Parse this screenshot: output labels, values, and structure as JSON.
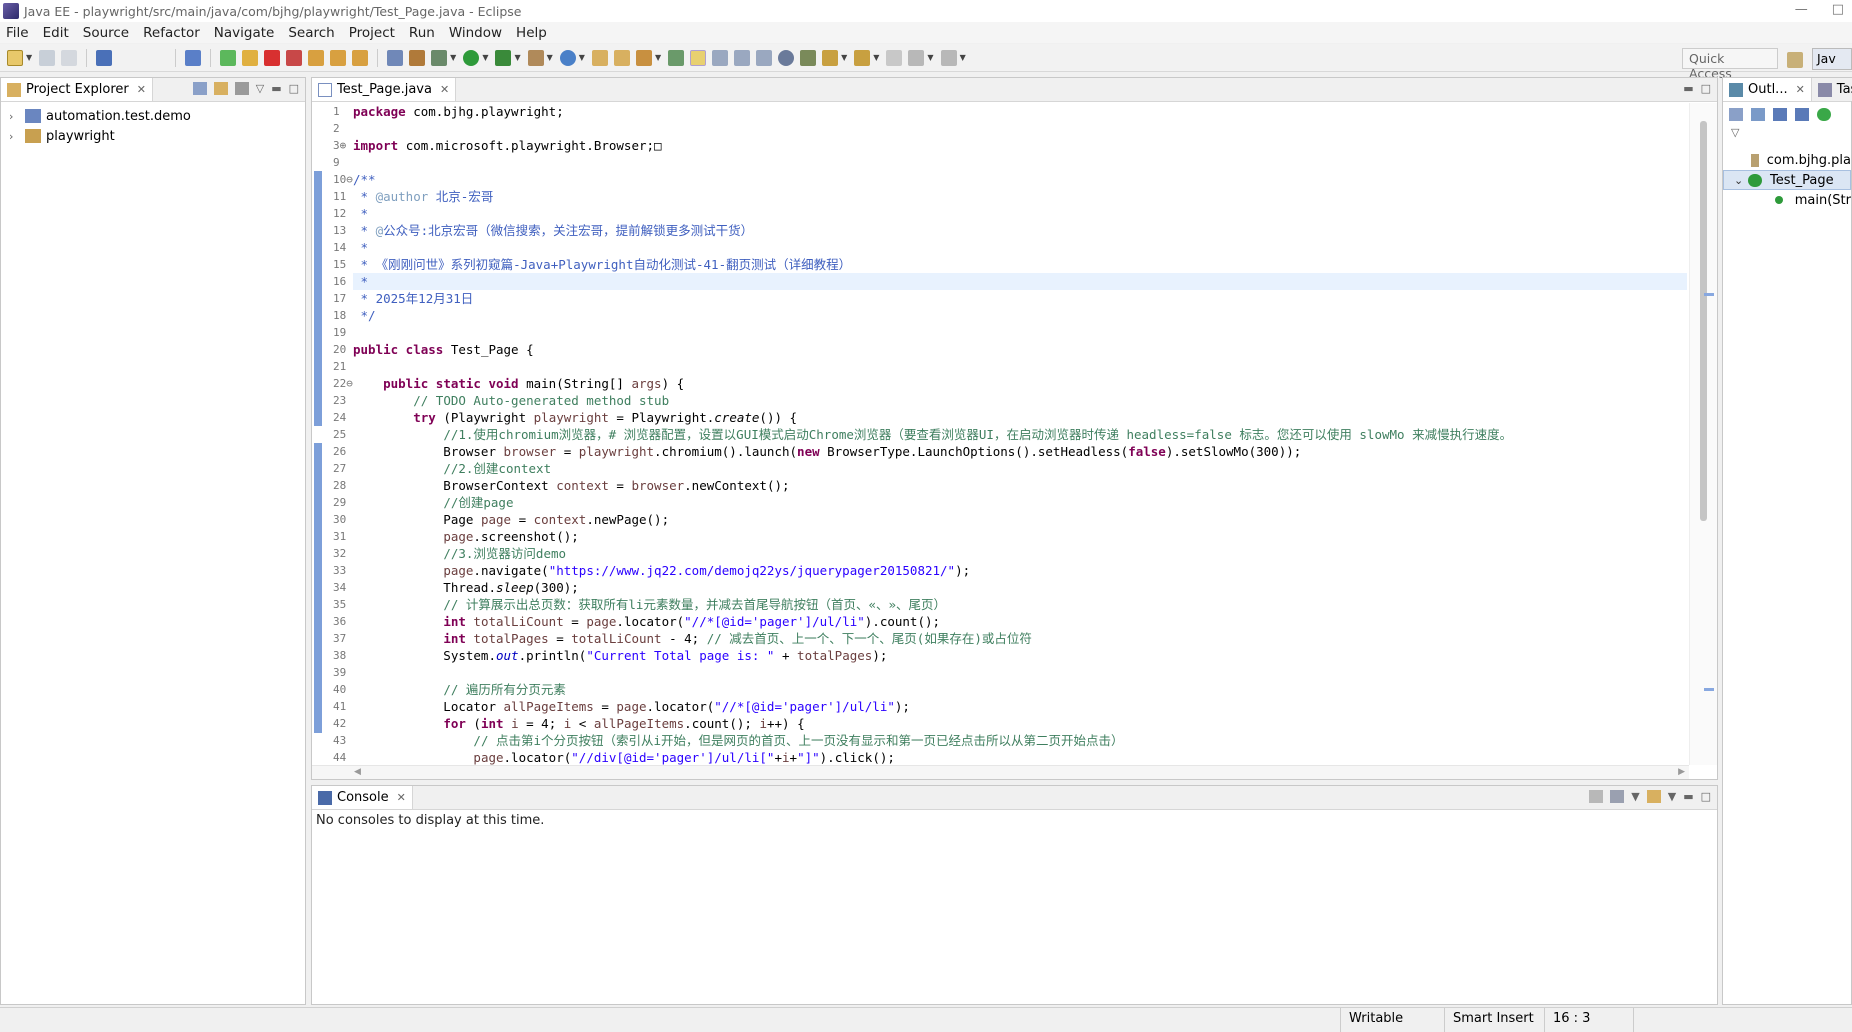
{
  "window": {
    "title": "Java EE - playwright/src/main/java/com/bjhg/playwright/Test_Page.java - Eclipse",
    "controls": [
      "—",
      "□"
    ]
  },
  "menu": [
    "File",
    "Edit",
    "Source",
    "Refactor",
    "Navigate",
    "Search",
    "Project",
    "Run",
    "Window",
    "Help"
  ],
  "toolbar": {
    "quick_access": "Quick Access",
    "perspective_label": "Jav"
  },
  "explorer": {
    "tab_label": "Project Explorer",
    "items": [
      {
        "label": "automation.test.demo"
      },
      {
        "label": "playwright"
      }
    ]
  },
  "editor": {
    "tab_label": "Test_Page.java",
    "line_numbers": [
      "1",
      "2",
      "3",
      "9",
      "10",
      "11",
      "12",
      "13",
      "14",
      "15",
      "16",
      "17",
      "18",
      "19",
      "20",
      "21",
      "22",
      "23",
      "24",
      "25",
      "26",
      "27",
      "28",
      "29",
      "30",
      "31",
      "32",
      "33",
      "34",
      "35",
      "36",
      "37",
      "38",
      "39",
      "40",
      "41",
      "42",
      "43",
      "44"
    ],
    "fold_markers": {
      "3": "⊕",
      "10": "⊖",
      "22": "⊖"
    },
    "highlighted_line_index": 10,
    "lines": [
      [
        [
          "kw",
          "package"
        ],
        [
          "",
          "com.bjhg.playwright;"
        ]
      ],
      [],
      [
        [
          "kw",
          "import"
        ],
        [
          "",
          "com.microsoft.playwright.Browser;□"
        ]
      ],
      [],
      [
        [
          "jd",
          "/**"
        ]
      ],
      [
        [
          "jd",
          " * "
        ],
        [
          "jdtag",
          "@author"
        ],
        [
          "jd",
          " 北京-宏哥"
        ]
      ],
      [
        [
          "jd",
          " *"
        ]
      ],
      [
        [
          "jd",
          " * "
        ],
        [
          "jdtag",
          "@"
        ],
        [
          "jd",
          "公众号:北京宏哥（微信搜索，关注宏哥，提前解锁更多测试干货）"
        ]
      ],
      [
        [
          "jd",
          " *"
        ]
      ],
      [
        [
          "jd",
          " * 《刚刚问世》系列初窥篇-Java+Playwright自动化测试-41-翻页测试（详细教程）"
        ]
      ],
      [
        [
          "jd",
          " *"
        ]
      ],
      [
        [
          "jd",
          " * 2025年12月31日"
        ]
      ],
      [
        [
          "jd",
          " */"
        ]
      ],
      [],
      [
        [
          "kw",
          "public class"
        ],
        [
          "",
          "Test_Page {"
        ]
      ],
      [],
      [
        [
          "",
          "    "
        ],
        [
          "kw",
          "public static void"
        ],
        [
          "",
          "main(String[] "
        ],
        [
          "var",
          "args"
        ],
        [
          "",
          ") {"
        ]
      ],
      [
        [
          "",
          "        "
        ],
        [
          "cm",
          "// TODO Auto-generated method stub"
        ]
      ],
      [
        [
          "",
          "        "
        ],
        [
          "kw",
          "try"
        ],
        [
          "",
          " (Playwright "
        ],
        [
          "var",
          "playwright"
        ],
        [
          "",
          " = Playwright."
        ],
        [
          "itl",
          "create"
        ],
        [
          "",
          "()) {"
        ]
      ],
      [
        [
          "",
          "            "
        ],
        [
          "cm",
          "//1.使用chromium浏览器，# 浏览器配置，设置以GUI模式启动Chrome浏览器（要查看浏览器UI，在启动浏览器时传递 headless=false 标志。您还可以使用 slowMo 来减慢执行速度。"
        ]
      ],
      [
        [
          "",
          "            Browser "
        ],
        [
          "var",
          "browser"
        ],
        [
          "",
          " = "
        ],
        [
          "var",
          "playwright"
        ],
        [
          "",
          ".chromium().launch("
        ],
        [
          "kw",
          "new"
        ],
        [
          "",
          " BrowserType.LaunchOptions().setHeadless("
        ],
        [
          "kw",
          "false"
        ],
        [
          "",
          ").setSlowMo(300));"
        ]
      ],
      [
        [
          "",
          "            "
        ],
        [
          "cm",
          "//2.创建context"
        ]
      ],
      [
        [
          "",
          "            BrowserContext "
        ],
        [
          "var",
          "context"
        ],
        [
          "",
          " = "
        ],
        [
          "var",
          "browser"
        ],
        [
          "",
          ".newContext();"
        ]
      ],
      [
        [
          "",
          "            "
        ],
        [
          "cm",
          "//创建page"
        ]
      ],
      [
        [
          "",
          "            Page "
        ],
        [
          "var",
          "page"
        ],
        [
          "",
          " = "
        ],
        [
          "var",
          "context"
        ],
        [
          "",
          ".newPage();"
        ]
      ],
      [
        [
          "",
          "            "
        ],
        [
          "var",
          "page"
        ],
        [
          "",
          ".screenshot();"
        ]
      ],
      [
        [
          "",
          "            "
        ],
        [
          "cm",
          "//3.浏览器访问demo"
        ]
      ],
      [
        [
          "",
          "            "
        ],
        [
          "var",
          "page"
        ],
        [
          "",
          ".navigate("
        ],
        [
          "st",
          "\"https://www.jq22.com/demojq22ys/jquerypager20150821/\""
        ],
        [
          "",
          ");"
        ]
      ],
      [
        [
          "",
          "            Thread."
        ],
        [
          "itl",
          "sleep"
        ],
        [
          "",
          "(300);"
        ]
      ],
      [
        [
          "",
          "            "
        ],
        [
          "cm",
          "// 计算展示出总页数：获取所有li元素数量，并减去首尾导航按钮（首页、«、»、尾页）"
        ]
      ],
      [
        [
          "",
          "            "
        ],
        [
          "kw",
          "int"
        ],
        [
          "",
          " "
        ],
        [
          "var",
          "totalLiCount"
        ],
        [
          "",
          " = "
        ],
        [
          "var",
          "page"
        ],
        [
          "",
          ".locator("
        ],
        [
          "st",
          "\"//*[@id='pager']/ul/li\""
        ],
        [
          "",
          ").count();"
        ]
      ],
      [
        [
          "",
          "            "
        ],
        [
          "kw",
          "int"
        ],
        [
          "",
          " "
        ],
        [
          "var",
          "totalPages"
        ],
        [
          "",
          " = "
        ],
        [
          "var",
          "totalLiCount"
        ],
        [
          "",
          " - 4; "
        ],
        [
          "cm",
          "// 减去首页、上一个、下一个、尾页(如果存在)或占位符"
        ]
      ],
      [
        [
          "",
          "            System."
        ],
        [
          "fld",
          "out"
        ],
        [
          "",
          ".println("
        ],
        [
          "st",
          "\"Current Total page is: \""
        ],
        [
          "",
          " + "
        ],
        [
          "var",
          "totalPages"
        ],
        [
          "",
          ");"
        ]
      ],
      [],
      [
        [
          "",
          "            "
        ],
        [
          "cm",
          "// 遍历所有分页元素"
        ]
      ],
      [
        [
          "",
          "            Locator "
        ],
        [
          "var",
          "allPageItems"
        ],
        [
          "",
          " = "
        ],
        [
          "var",
          "page"
        ],
        [
          "",
          ".locator("
        ],
        [
          "st",
          "\"//*[@id='pager']/ul/li\""
        ],
        [
          "",
          ");"
        ]
      ],
      [
        [
          "",
          "            "
        ],
        [
          "kw",
          "for"
        ],
        [
          "",
          " ("
        ],
        [
          "kw",
          "int"
        ],
        [
          "",
          " "
        ],
        [
          "var",
          "i"
        ],
        [
          "",
          " = 4; "
        ],
        [
          "var",
          "i"
        ],
        [
          "",
          " < "
        ],
        [
          "var",
          "allPageItems"
        ],
        [
          "",
          ".count(); "
        ],
        [
          "var",
          "i"
        ],
        [
          "",
          "++) {"
        ]
      ],
      [
        [
          "",
          "                "
        ],
        [
          "cm",
          "// 点击第i个分页按钮（索引从i开始，但是网页的首页、上一页没有显示和第一页已经点击所以从第二页开始点击）"
        ]
      ],
      [
        [
          "",
          "                "
        ],
        [
          "var",
          "page"
        ],
        [
          "",
          ".locator("
        ],
        [
          "st",
          "\"//div[@id='pager']/ul/li[\""
        ],
        [
          "",
          "+"
        ],
        [
          "var",
          "i"
        ],
        [
          "",
          "+"
        ],
        [
          "st",
          "\"]\""
        ],
        [
          "",
          ").click();"
        ]
      ]
    ]
  },
  "console": {
    "tab_label": "Console",
    "message": "No consoles to display at this time."
  },
  "outline": {
    "tabs": [
      "Outl...",
      "Tas"
    ],
    "items": [
      {
        "label": "com.bjhg.pla"
      },
      {
        "label": "Test_Page"
      },
      {
        "label": "main(Str"
      }
    ]
  },
  "status": {
    "writable": "Writable",
    "insert_mode": "Smart Insert",
    "position": "16 : 3"
  },
  "colors": {
    "keyword": "#7f0055",
    "comment": "#3f7f5f",
    "javadoc": "#3f5fbf",
    "string": "#2a00ff",
    "current_line": "#e8f2fe",
    "annotation_bar": "#7d9fd9"
  }
}
